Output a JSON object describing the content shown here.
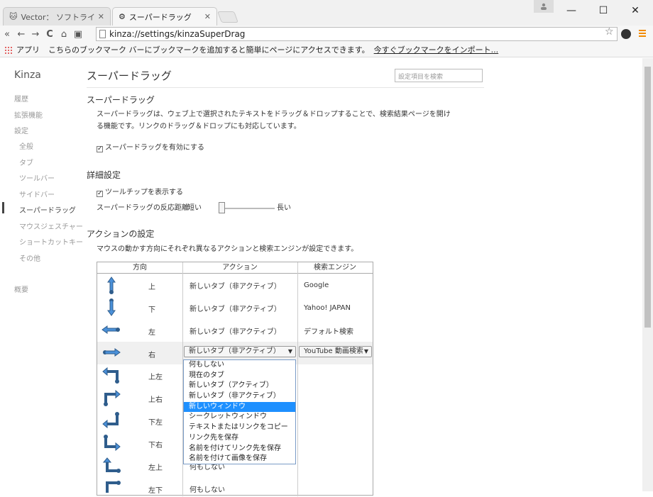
{
  "tabs": [
    {
      "label": "Vector： ソフトライブラ",
      "icon": "cat-icon"
    },
    {
      "label": "スーパードラッグ",
      "icon": "gear-icon"
    }
  ],
  "window": {
    "minimize": "—",
    "maximize": "☐",
    "close": "✕",
    "user": "user-icon"
  },
  "toolbar": {
    "back": "«",
    "back_arrow": "←",
    "forward": "→",
    "reload": "C",
    "home": "⌂",
    "url": "kinza://settings/kinzaSuperDrag",
    "star": "☆"
  },
  "bookmarks": {
    "apps": "アプリ",
    "message": "こちらのブックマーク バーにブックマークを追加すると簡単にページにアクセスできます。",
    "import_link": "今すぐブックマークをインポート..."
  },
  "sidebar": {
    "brand": "Kinza",
    "items": [
      "履歴",
      "拡張機能",
      "設定",
      "全般",
      "タブ",
      "ツールバー",
      "サイドバー",
      "スーパードラッグ",
      "マウスジェスチャー",
      "ショートカットキー",
      "その他",
      "概要"
    ]
  },
  "main": {
    "page_title": "スーパードラッグ",
    "search_placeholder": "設定項目を検索",
    "section1": {
      "title": "スーパードラッグ",
      "desc1": "スーパードラッグは、ウェブ上で選択されたテキストをドラッグ＆ドロップすることで、検索結果ページを開け",
      "desc2": "る機能です。リンクのドラッグ＆ドロップにも対応しています。",
      "enable": "スーパードラッグを有効にする"
    },
    "section2": {
      "title": "詳細設定",
      "tooltip": "ツールチップを表示する",
      "distance_label": "スーパードラッグの反応距離",
      "short": "短い",
      "long": "長い"
    },
    "section3": {
      "title": "アクションの設定",
      "desc": "マウスの動かす方向にそれぞれ異なるアクションと検索エンジンが設定できます。"
    }
  },
  "table": {
    "headers": [
      "方向",
      "アクション",
      "検索エンジン"
    ],
    "rows": [
      {
        "dir": "上",
        "action": "新しいタブ（非アクティブ）",
        "engine": "Google"
      },
      {
        "dir": "下",
        "action": "新しいタブ（非アクティブ）",
        "engine": "Yahoo! JAPAN"
      },
      {
        "dir": "左",
        "action": "新しいタブ（非アクティブ）",
        "engine": "デフォルト検索"
      },
      {
        "dir": "右",
        "action": "新しいタブ（非アクティブ）",
        "engine": "YouTube 動画検索"
      },
      {
        "dir": "上左",
        "action": "",
        "engine": ""
      },
      {
        "dir": "上右",
        "action": "",
        "engine": ""
      },
      {
        "dir": "下左",
        "action": "",
        "engine": ""
      },
      {
        "dir": "下右",
        "action": "",
        "engine": ""
      },
      {
        "dir": "左上",
        "action": "何もしない",
        "engine": ""
      },
      {
        "dir": "左下",
        "action": "何もしない",
        "engine": ""
      }
    ],
    "dropdown_arrow": "▼"
  },
  "dropdown": {
    "options": [
      "何もしない",
      "現在のタブ",
      "新しいタブ（アクティブ）",
      "新しいタブ（非アクティブ）",
      "新しいウィンドウ",
      "シークレットウィンドウ",
      "テキストまたはリンクをコピー",
      "リンク先を保存",
      "名前を付けてリンク先を保存",
      "名前を付けて画像を保存"
    ],
    "highlighted_index": 4
  },
  "colors": {
    "arrow": "#2f5d8c",
    "arrow_light": "#4a90d9",
    "highlight": "#1e90ff",
    "accent": "#f28b00"
  }
}
